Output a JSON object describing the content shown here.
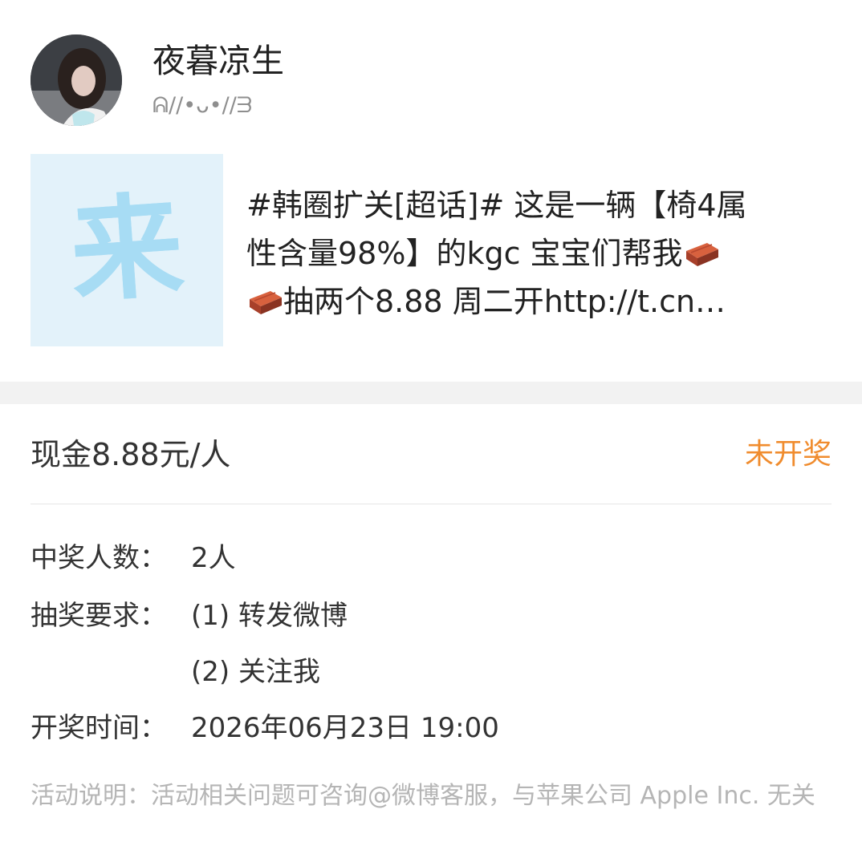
{
  "header": {
    "username": "夜暮凉生",
    "signature": "ᕱ//•ᴗ•//ᗱ",
    "avatar_icon": "user-avatar-photo"
  },
  "post": {
    "thumb_char": "来",
    "text_line1": "#韩圈扩关[超话]# 这是一辆【椅4属",
    "text_line2": "性含量98%】的kgc 宝宝们帮我",
    "text_line3": "抽两个8.88 周二开http://t.cn…",
    "emoji_icon": "brick-emoji-icon"
  },
  "prize": {
    "title": "现金8.88元/人",
    "status": "未开奖",
    "status_color": "#f08c2e"
  },
  "details": {
    "winners_label": "中奖人数：",
    "winners_value": "2人",
    "requirements_label": "抽奖要求：",
    "requirement_1": "(1) 转发微博",
    "requirement_2": "(2) 关注我",
    "draw_time_label": "开奖时间：",
    "draw_time_value": "2026年06月23日 19:00"
  },
  "note": {
    "text": "活动说明：活动相关问题可咨询@微博客服，与苹果公司 Apple Inc. 无关"
  }
}
